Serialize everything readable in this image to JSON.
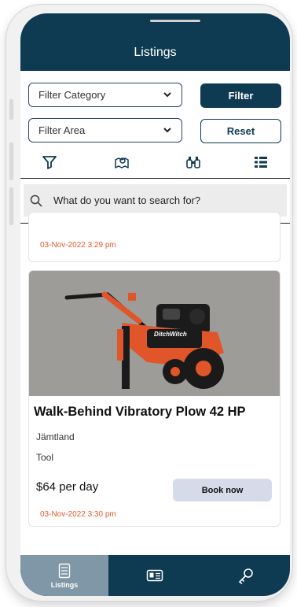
{
  "header": {
    "title": "Listings"
  },
  "filters": {
    "category_placeholder": "Filter Category",
    "area_placeholder": "Filter Area",
    "filter_label": "Filter",
    "reset_label": "Reset"
  },
  "iconbar": [
    "filter-icon",
    "map-pin-icon",
    "binoculars-icon",
    "list-icon"
  ],
  "search": {
    "placeholder": "What do you want to search for?"
  },
  "listings": [
    {
      "date": "03-Nov-2022 3:29 pm"
    },
    {
      "title": "Walk-Behind Vibratory Plow 42 HP",
      "area": "Jämtland",
      "category": "Tool",
      "price": "$64 per day",
      "book_label": "Book now",
      "date": "03-Nov-2022 3:30 pm",
      "photo_brand": "DitchWitch"
    }
  ],
  "tabs": [
    {
      "label": "Listings",
      "icon": "listing-doc-icon",
      "active": true
    },
    {
      "label": "",
      "icon": "id-card-icon",
      "active": false
    },
    {
      "label": "",
      "icon": "key-icon",
      "active": false
    }
  ],
  "colors": {
    "primary": "#0e3a52",
    "accent_date": "#e45a2a",
    "tab_active": "#7f97a6"
  }
}
